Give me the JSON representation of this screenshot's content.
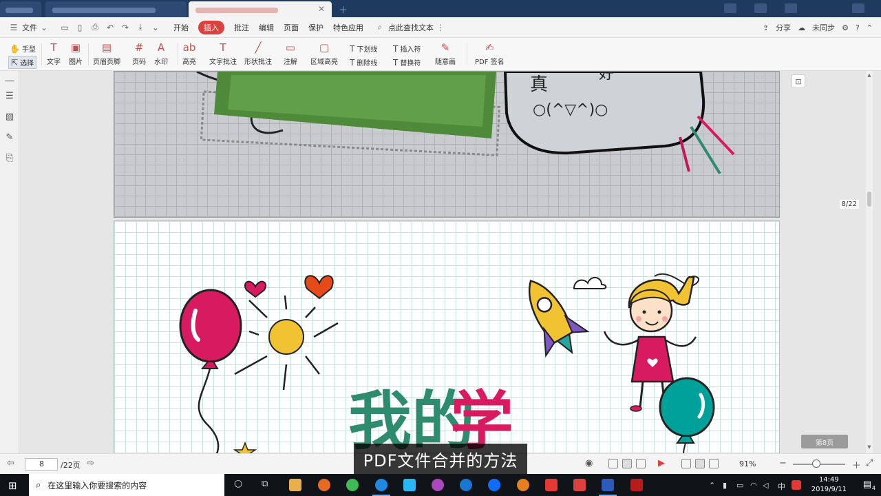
{
  "colors": {
    "accent": "#d9423f",
    "taskbar": "#101418",
    "tab_bg": "#1f3a5f"
  },
  "menubar": {
    "file": "文件",
    "tabs": [
      "开始",
      "插入",
      "批注",
      "编辑",
      "页面",
      "保护",
      "特色应用"
    ],
    "active_tab": "插入",
    "search_text": "点此查找文本",
    "share": "分享",
    "sync": "未同步"
  },
  "ribbon": {
    "hand": "手型",
    "select": "选择",
    "text": "文字",
    "image": "图片",
    "header_footer": "页眉页脚",
    "page_number": "页码",
    "watermark": "水印",
    "highlight": "高亮",
    "text_annotation": "文字批注",
    "shape_annotation": "形状批注",
    "note": "注解",
    "area_highlight": "区域高亮",
    "underline": "下划线",
    "strikethrough": "删除线",
    "insert_char": "插入符",
    "replace_char": "替换符",
    "freehand": "随意画",
    "pdf_sign": "PDF 签名"
  },
  "document": {
    "page_indicator": "8/22",
    "page_label": "第8页",
    "speech_text_1": "真",
    "speech_text_2": "好",
    "kaomoji": "○(^▽^)○",
    "title_part_1": "我的",
    "title_part_2": "学"
  },
  "statusbar": {
    "current_page": "8",
    "total_pages": "/22页",
    "zoom": "91%"
  },
  "subtitle": "PDF文件合并的方法",
  "taskbar": {
    "search_placeholder": "在这里输入你要搜索的内容",
    "time": "14:49",
    "date": "2019/9/11",
    "ime": "中",
    "notifications": "4"
  }
}
